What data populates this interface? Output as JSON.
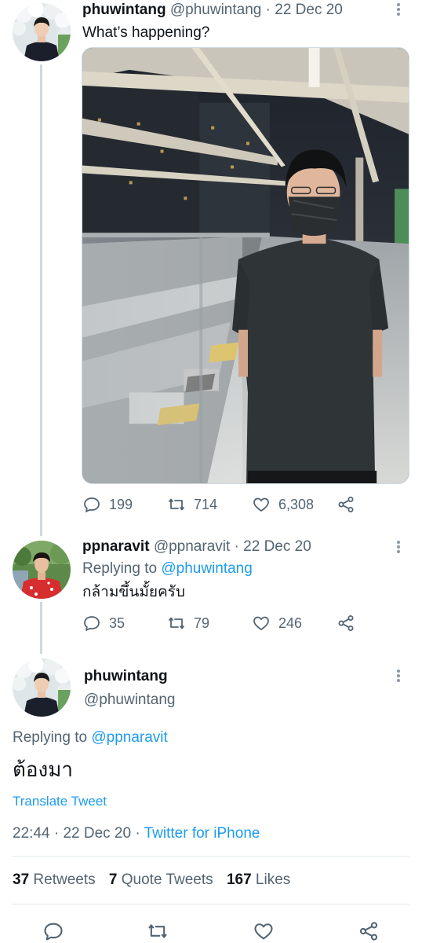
{
  "tweet1": {
    "name": "phuwintang",
    "handle": "@phuwintang",
    "dot": "·",
    "date": "22 Dec 20",
    "text": "What’s happening?",
    "replies": "199",
    "retweets": "714",
    "likes": "6,308"
  },
  "tweet2": {
    "name": "ppnaravit",
    "handle": "@ppnaravit",
    "dot": "·",
    "date": "22 Dec 20",
    "replying_prefix": "Replying to",
    "replying_to": "@phuwintang",
    "text": "กล้ามขึ้นมั้ยครับ",
    "replies": "35",
    "retweets": "79",
    "likes": "246"
  },
  "main": {
    "name": "phuwintang",
    "handle": "@phuwintang",
    "replying_prefix": "Replying to",
    "replying_to": "@ppnaravit",
    "text": "ต้องมา",
    "translate": "Translate Tweet",
    "time": "22:44",
    "dot": "·",
    "date": "22 Dec 20",
    "dot2": "·",
    "client": "Twitter for iPhone",
    "retweets_count": "37",
    "retweets_label": "Retweets",
    "quotes_count": "7",
    "quotes_label": "Quote Tweets",
    "likes_count": "167",
    "likes_label": "Likes"
  },
  "colors": {
    "accent": "#1d9bf0",
    "muted": "#536471",
    "thread_line": "#cfd9de"
  },
  "icons": [
    "reply-icon",
    "retweet-icon",
    "like-icon",
    "share-icon",
    "more-icon"
  ]
}
